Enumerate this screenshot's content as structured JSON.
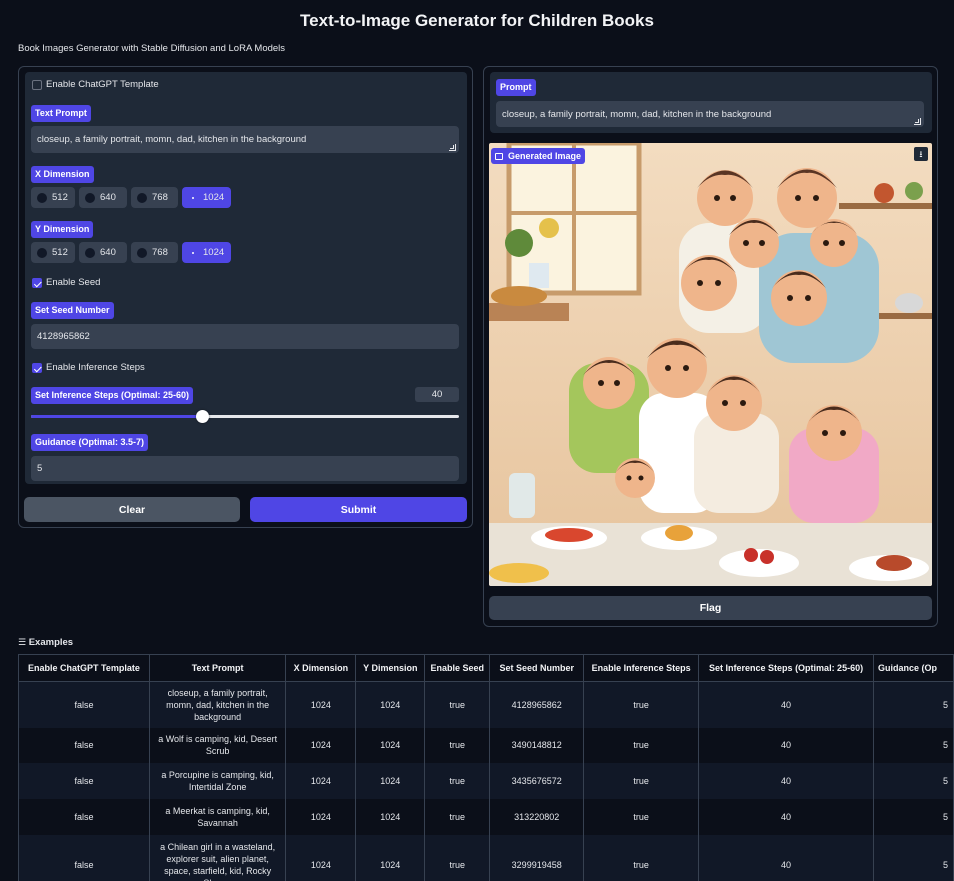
{
  "header": {
    "title": "Text-to-Image Generator for Children Books",
    "subtitle": "Book Images Generator with Stable Diffusion and LoRA Models"
  },
  "form": {
    "chatgpt_label": "Enable ChatGPT Template",
    "chatgpt_checked": false,
    "text_prompt_label": "Text Prompt",
    "text_prompt_value": "closeup, a family portrait, momn, dad, kitchen in the background",
    "x_dim_label": "X Dimension",
    "y_dim_label": "Y Dimension",
    "dim_options": [
      "512",
      "640",
      "768",
      "1024"
    ],
    "x_selected": "1024",
    "y_selected": "1024",
    "enable_seed_label": "Enable Seed",
    "enable_seed_checked": true,
    "seed_label": "Set Seed Number",
    "seed_value": "4128965862",
    "enable_steps_label": "Enable Inference Steps",
    "enable_steps_checked": true,
    "steps_label": "Set Inference Steps (Optimal: 25-60)",
    "steps_value": "40",
    "steps_fraction": 0.4,
    "guidance_label": "Guidance (Optimal: 3.5-7)",
    "guidance_value": "5",
    "clear_label": "Clear",
    "submit_label": "Submit"
  },
  "output": {
    "prompt_label": "Prompt",
    "prompt_value": "closeup, a family portrait, momn, dad, kitchen in the background",
    "image_label": "Generated Image",
    "flag_label": "Flag"
  },
  "examples": {
    "title": "Examples",
    "columns": [
      "Enable ChatGPT Template",
      "Text Prompt",
      "X Dimension",
      "Y Dimension",
      "Enable Seed",
      "Set Seed Number",
      "Enable Inference Steps",
      "Set Inference Steps (Optimal: 25-60)",
      "Guidance (Op"
    ],
    "rows": [
      [
        "false",
        "closeup, a family portrait, momn, dad, kitchen in the background",
        "1024",
        "1024",
        "true",
        "4128965862",
        "true",
        "40",
        "5"
      ],
      [
        "false",
        "a Wolf is camping, kid, Desert Scrub",
        "1024",
        "1024",
        "true",
        "3490148812",
        "true",
        "40",
        "5"
      ],
      [
        "false",
        "a Porcupine is camping, kid, Intertidal Zone",
        "1024",
        "1024",
        "true",
        "3435676572",
        "true",
        "40",
        "5"
      ],
      [
        "false",
        "a Meerkat is camping, kid, Savannah",
        "1024",
        "1024",
        "true",
        "313220802",
        "true",
        "40",
        "5"
      ],
      [
        "false",
        "a Chilean girl in a wasteland, explorer suit, alien planet, space, starfield, kid, Rocky Shores",
        "1024",
        "1024",
        "true",
        "3299919458",
        "true",
        "40",
        "5"
      ]
    ]
  },
  "colors": {
    "accent": "#4f46e5",
    "background": "#0b0f19",
    "panel": "#1f2937",
    "input": "#374151"
  }
}
